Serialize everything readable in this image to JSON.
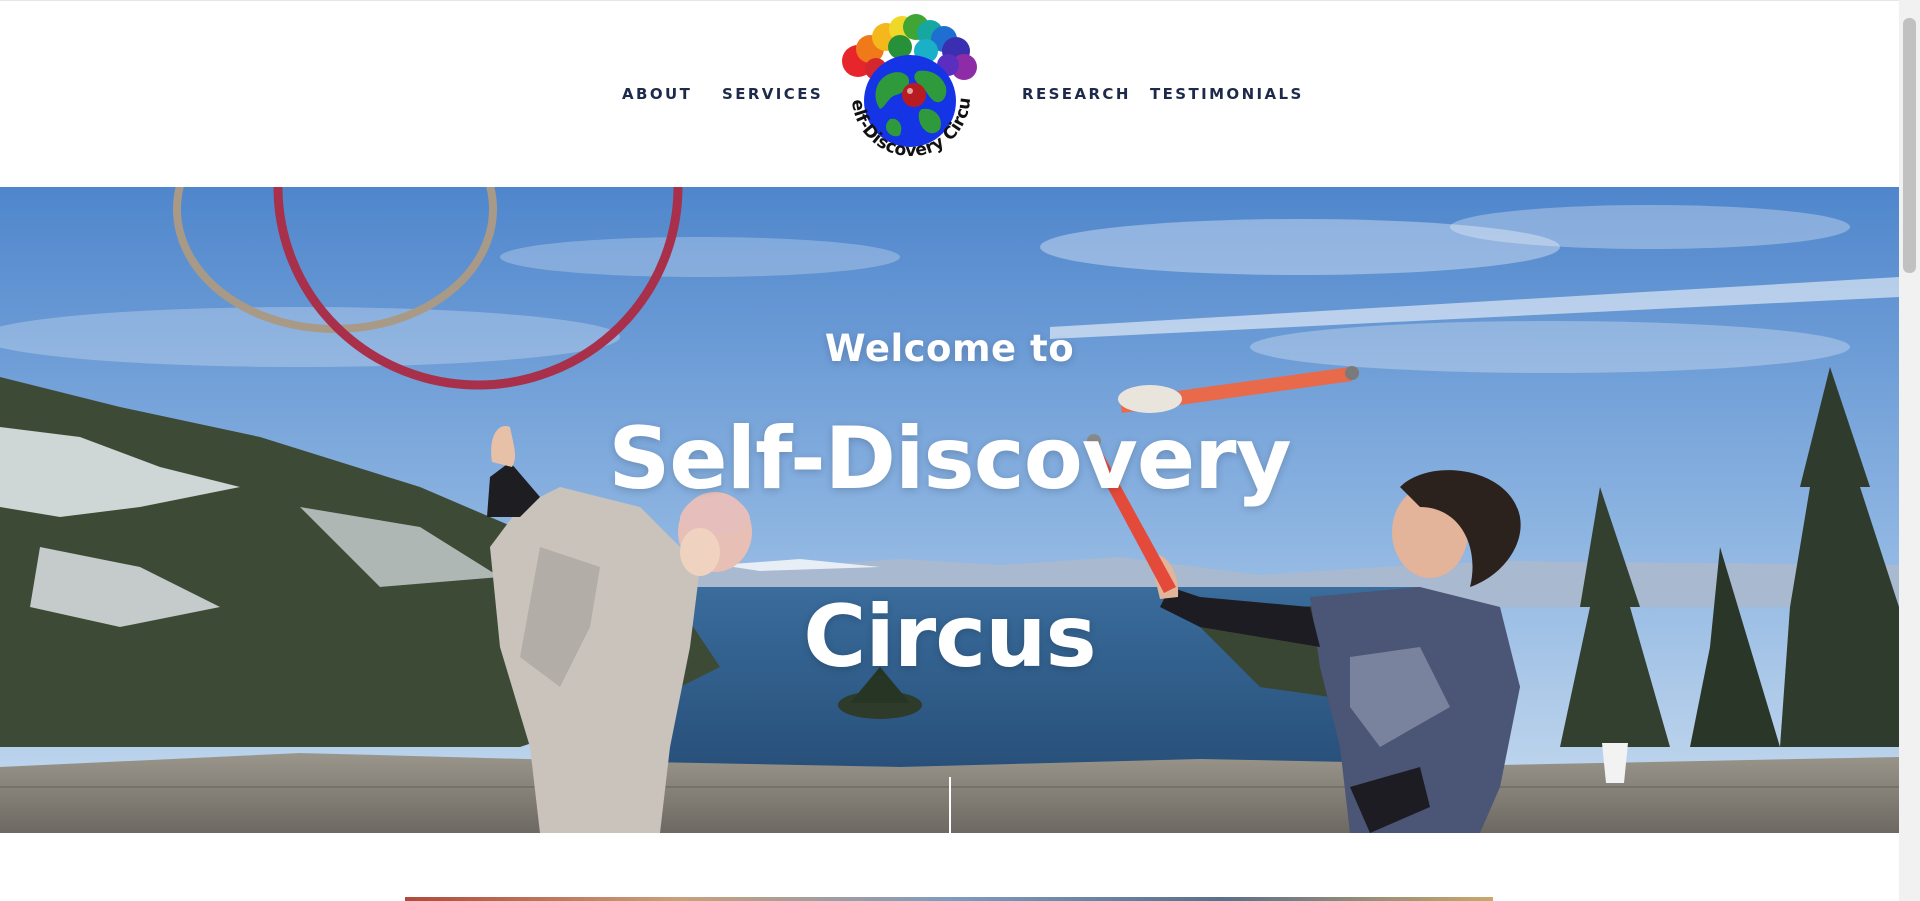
{
  "nav": {
    "left": [
      {
        "label": "ABOUT"
      },
      {
        "label": "SERVICES"
      }
    ],
    "right": [
      {
        "label": "RESEARCH"
      },
      {
        "label": "TESTIMONIALS"
      }
    ],
    "logo_text": "Self-Discovery Circus"
  },
  "hero": {
    "welcome": "Welcome to",
    "title_line1": "Self-Discovery",
    "title_line2": "Circus"
  },
  "colors": {
    "nav_text": "#1d2a4a",
    "hero_text": "#ffffff",
    "sky": "#5b8fd0",
    "lake": "#2f5d8c"
  }
}
